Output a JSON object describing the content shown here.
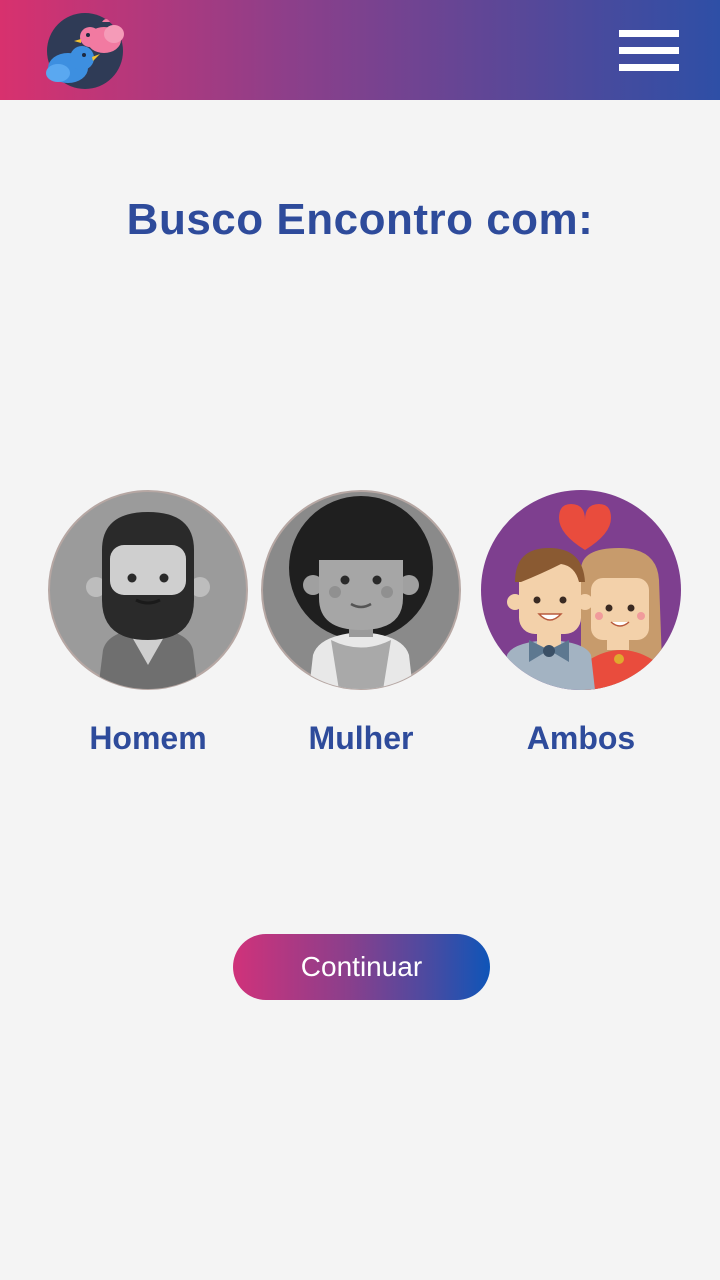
{
  "header": {
    "logo_icon": "birds-logo-icon",
    "menu_icon": "hamburger-menu-icon",
    "gradient_colors": [
      "#d8316e",
      "#2e4fa6"
    ]
  },
  "main": {
    "title": "Busco Encontro com:",
    "options": [
      {
        "label": "Homem",
        "icon": "man-avatar-icon",
        "selected": false
      },
      {
        "label": "Mulher",
        "icon": "woman-avatar-icon",
        "selected": false
      },
      {
        "label": "Ambos",
        "icon": "couple-avatar-icon",
        "selected": true
      }
    ]
  },
  "continue_button": {
    "label": "Continuar"
  },
  "colors": {
    "accent": "#2e4b9b",
    "background": "#f4f4f4",
    "selected_circle": "#7e3f8f"
  }
}
